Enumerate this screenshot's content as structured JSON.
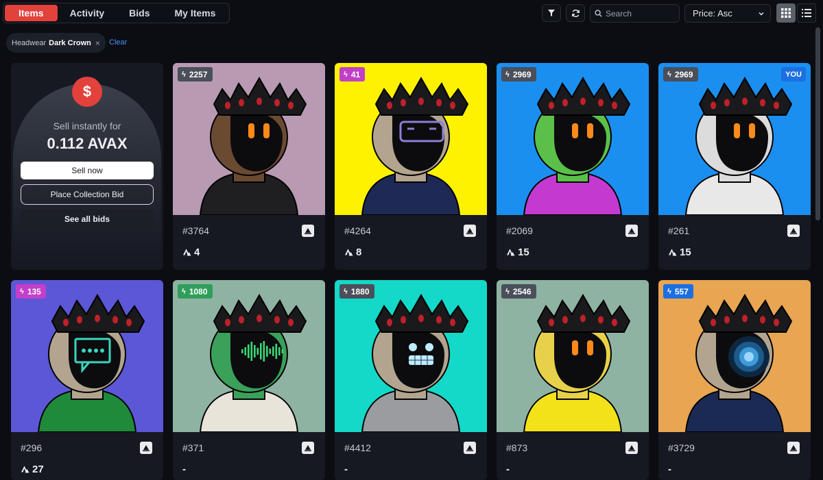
{
  "tabs": [
    {
      "label": "Items",
      "active": true
    },
    {
      "label": "Activity",
      "active": false
    },
    {
      "label": "Bids",
      "active": false
    },
    {
      "label": "My Items",
      "active": false
    }
  ],
  "toolbar": {
    "search_placeholder": "Search",
    "sort_label": "Price: Asc",
    "filter_icon": "filter-icon",
    "refresh_icon": "refresh-icon",
    "grid_view_icon": "grid-view-icon",
    "list_view_icon": "list-view-icon",
    "grid_view_active": true
  },
  "filter_chip": {
    "key": "Headwear",
    "value": "Dark Crown",
    "remove": "×",
    "clear_label": "Clear"
  },
  "sell_panel": {
    "icon": "$",
    "label": "Sell instantly for",
    "price": "0.112 AVAX",
    "sell_now": "Sell now",
    "place_bid": "Place Collection Bid",
    "see_all": "See all bids"
  },
  "colors": {
    "accent": "#e3413b",
    "link": "#4c8ff5",
    "card_bg": "#161922",
    "page_bg": "#0b0d12"
  },
  "items": [
    {
      "name": "#3764",
      "rank": "2257",
      "price": "4",
      "bg": "#b89ab3",
      "rank_color": "#4a4f5a",
      "you": false,
      "face": "blank",
      "body": "#1f1f22",
      "skin": "#6b4a32"
    },
    {
      "name": "#4264",
      "rank": "41",
      "price": "8",
      "bg": "#fff200",
      "rank_color": "#c23fc9",
      "you": false,
      "face": "visor",
      "body": "#1e2a55",
      "skin": "#b3a48f"
    },
    {
      "name": "#2069",
      "rank": "2969",
      "price": "15",
      "bg": "#1a8ff0",
      "rank_color": "#4a4f5a",
      "you": false,
      "face": "blank",
      "body": "#c43ad1",
      "skin": "#5bc04a"
    },
    {
      "name": "#261",
      "rank": "2969",
      "price": "15",
      "bg": "#1a8ff0",
      "rank_color": "#4a4f5a",
      "you": true,
      "you_label": "YOU",
      "face": "blank",
      "body": "#e8e8e8",
      "skin": "#dcdcdc"
    },
    {
      "name": "#296",
      "rank": "135",
      "price": "27",
      "bg": "#5b57d6",
      "rank_color": "#c23fc9",
      "you": false,
      "face": "chat",
      "body": "#1e8a3a",
      "skin": "#b3a48f"
    },
    {
      "name": "#371",
      "rank": "1080",
      "price": "-",
      "bg": "#8fb3a3",
      "rank_color": "#2f9e5a",
      "you": false,
      "face": "wave",
      "body": "#e8e4da",
      "skin": "#3aa05a"
    },
    {
      "name": "#4412",
      "rank": "1880",
      "price": "-",
      "bg": "#14d8c8",
      "rank_color": "#4a4f5a",
      "you": false,
      "face": "cold",
      "body": "#9a9ca0",
      "skin": "#b3a48f"
    },
    {
      "name": "#873",
      "rank": "2546",
      "price": "-",
      "bg": "#8fb3a3",
      "rank_color": "#4a4f5a",
      "you": false,
      "face": "blank",
      "body": "#f3e21a",
      "skin": "#e8d14a"
    },
    {
      "name": "#3729",
      "rank": "557",
      "price": "-",
      "bg": "#e8a552",
      "rank_color": "#1c6fe0",
      "you": false,
      "face": "eye",
      "body": "#1a2a55",
      "skin": "#b3a48f"
    }
  ]
}
